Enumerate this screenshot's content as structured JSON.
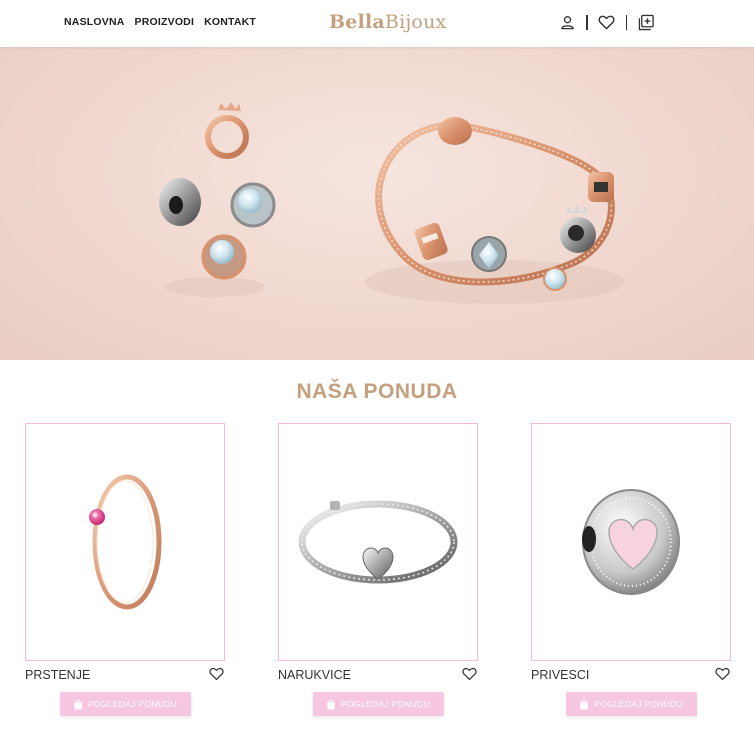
{
  "header": {
    "nav": [
      "NASLOVNA",
      "PROIZVODI",
      "KONTAKT"
    ],
    "logo_part1": "Bella",
    "logo_part2": "Bijoux",
    "icons": [
      "user-icon",
      "heart-icon",
      "add-to-cart-icon"
    ]
  },
  "hero": {
    "image": "rose-gold-bracelet-and-charms-photo"
  },
  "section": {
    "title": "NAŠA PONUDA"
  },
  "products": [
    {
      "name": "PRSTENJE",
      "button": "POGLEDAJ PONUDU",
      "image": "rose-gold-ring-with-pink-stone"
    },
    {
      "name": "NARUKVICE",
      "button": "POGLEDAJ PONUDU",
      "image": "silver-snake-chain-bracelet"
    },
    {
      "name": "PRIVESCI",
      "button": "POGLEDAJ PONUDU",
      "image": "pink-heart-sparkle-charm"
    }
  ],
  "colors": {
    "brand": "#c4a07e",
    "button": "#f7c6e1",
    "card_border": "#f2b9d9",
    "hero_bg": "#eed4ca"
  }
}
